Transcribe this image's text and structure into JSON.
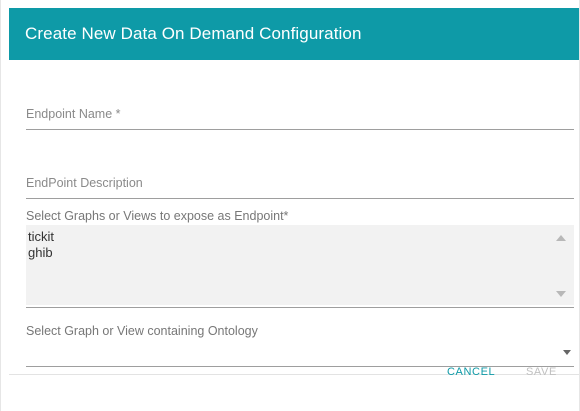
{
  "dialog": {
    "title": "Create New Data On Demand Configuration"
  },
  "fields": {
    "endpoint_name": {
      "placeholder": "Endpoint Name *",
      "value": ""
    },
    "endpoint_description": {
      "placeholder": "EndPoint Description",
      "value": ""
    },
    "graphs_select": {
      "label": "Select Graphs or Views to expose as Endpoint*",
      "options": [
        "tickit",
        "ghib"
      ]
    },
    "ontology_select": {
      "label": "Select Graph or View containing Ontology",
      "value": ""
    }
  },
  "actions": {
    "cancel_label": "CANCEL",
    "save_label": "SAVE"
  },
  "colors": {
    "header": "#0e9aa7",
    "accent": "#0e9aa7",
    "disabled": "#c0c0c0"
  },
  "icons": {
    "scroll_up": "scroll-up-icon",
    "scroll_down": "scroll-down-icon",
    "dropdown": "chevron-down-icon"
  }
}
